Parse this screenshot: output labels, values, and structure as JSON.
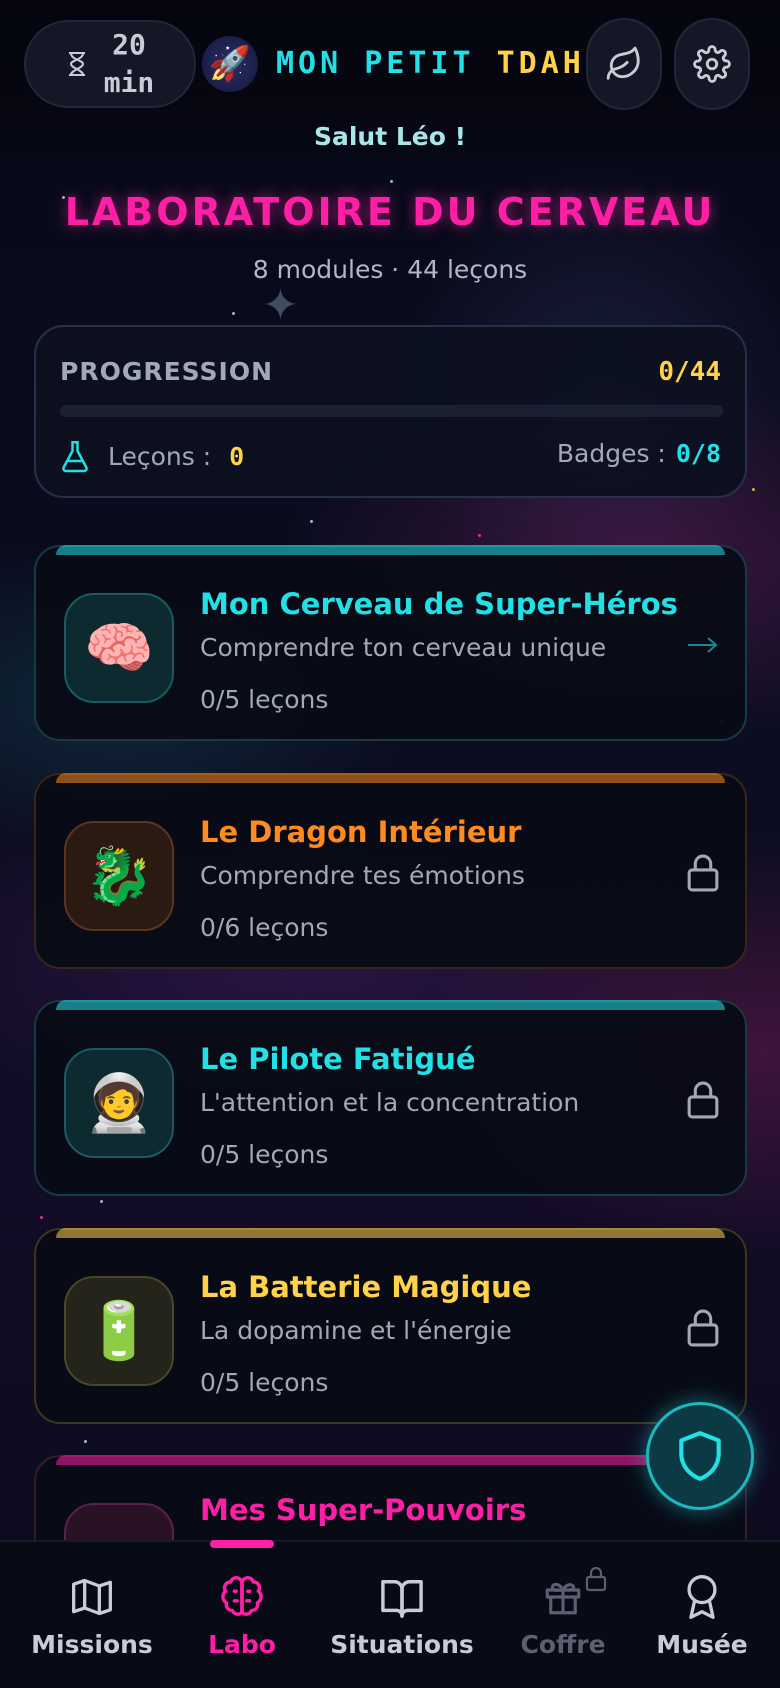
{
  "header": {
    "timer_value": "20",
    "timer_unit": "min",
    "brand_part1": "MON PETIT",
    "brand_part2": "TDAH",
    "logo_emoji": "🚀",
    "greeting": "Salut Léo !"
  },
  "page": {
    "title": "LABORATOIRE DU CERVEAU",
    "subtitle": "8 modules · 44 leçons"
  },
  "progress": {
    "label": "PROGRESSION",
    "count": "0/44",
    "fraction": 0,
    "lessons_label": "Leçons :",
    "lessons_value": "0",
    "badges_label": "Badges :",
    "badges_value": "0/8"
  },
  "modules": [
    {
      "title": "Mon Cerveau de Super-Héros",
      "description": "Comprendre ton cerveau unique",
      "count": "0/5 leçons",
      "emoji": "🧠",
      "color": "#22e1e6",
      "status": "unlocked"
    },
    {
      "title": "Le Dragon Intérieur",
      "description": "Comprendre tes émotions",
      "count": "0/6 leçons",
      "emoji": "🐉",
      "color": "#ff8a1f",
      "status": "locked"
    },
    {
      "title": "Le Pilote Fatigué",
      "description": "L'attention et la concentration",
      "count": "0/5 leçons",
      "emoji": "🧑‍🚀",
      "color": "#22e1e6",
      "status": "locked"
    },
    {
      "title": "La Batterie Magique",
      "description": "La dopamine et l'énergie",
      "count": "0/5 leçons",
      "emoji": "🔋",
      "color": "#ffd24a",
      "status": "locked"
    },
    {
      "title": "Mes Super-Pouvoirs",
      "description": "",
      "count": "",
      "emoji": "",
      "color": "#ff1fa6",
      "status": "locked"
    }
  ],
  "nav": {
    "items": [
      {
        "label": "Missions",
        "icon": "map-icon"
      },
      {
        "label": "Labo",
        "icon": "brain-icon",
        "active": true
      },
      {
        "label": "Situations",
        "icon": "book-icon"
      },
      {
        "label": "Coffre",
        "icon": "gift-icon",
        "locked": true
      },
      {
        "label": "Musée",
        "icon": "medal-icon"
      }
    ]
  },
  "colors": {
    "accent_pink": "#ff1fa6",
    "accent_cyan": "#22e1e6",
    "accent_yellow": "#ffd24a",
    "accent_orange": "#ff8a1f"
  }
}
